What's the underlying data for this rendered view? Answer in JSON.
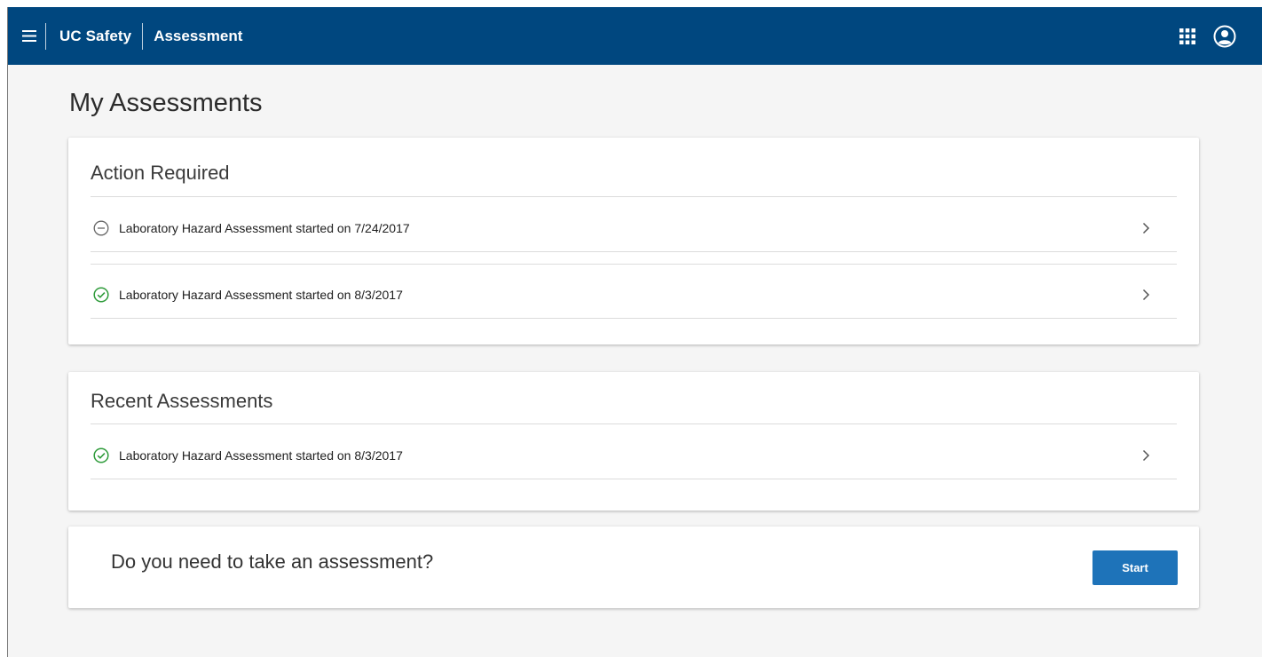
{
  "header": {
    "app_name": "UC Safety",
    "section": "Assessment",
    "bg_color": "#00477f",
    "icons": {
      "menu": "hamburger-icon",
      "apps": "apps-grid-icon",
      "account": "account-circle-icon"
    }
  },
  "page": {
    "title": "My Assessments"
  },
  "action_required": {
    "title": "Action Required",
    "items": [
      {
        "label": "Laboratory Hazard Assessment started on 7/24/2017",
        "status": "in-progress",
        "icon": "minus-circle-icon"
      },
      {
        "label": "Laboratory Hazard Assessment started on 8/3/2017",
        "status": "complete",
        "icon": "check-circle-icon"
      }
    ]
  },
  "recent": {
    "title": "Recent Assessments",
    "items": [
      {
        "label": "Laboratory Hazard Assessment started on 8/3/2017",
        "status": "complete",
        "icon": "check-circle-icon"
      }
    ]
  },
  "start_card": {
    "question": "Do you need to take an assessment?",
    "button_label": "Start",
    "button_color": "#1e73b9"
  },
  "colors": {
    "success": "#2e9b3a",
    "neutral_icon": "#666666"
  }
}
